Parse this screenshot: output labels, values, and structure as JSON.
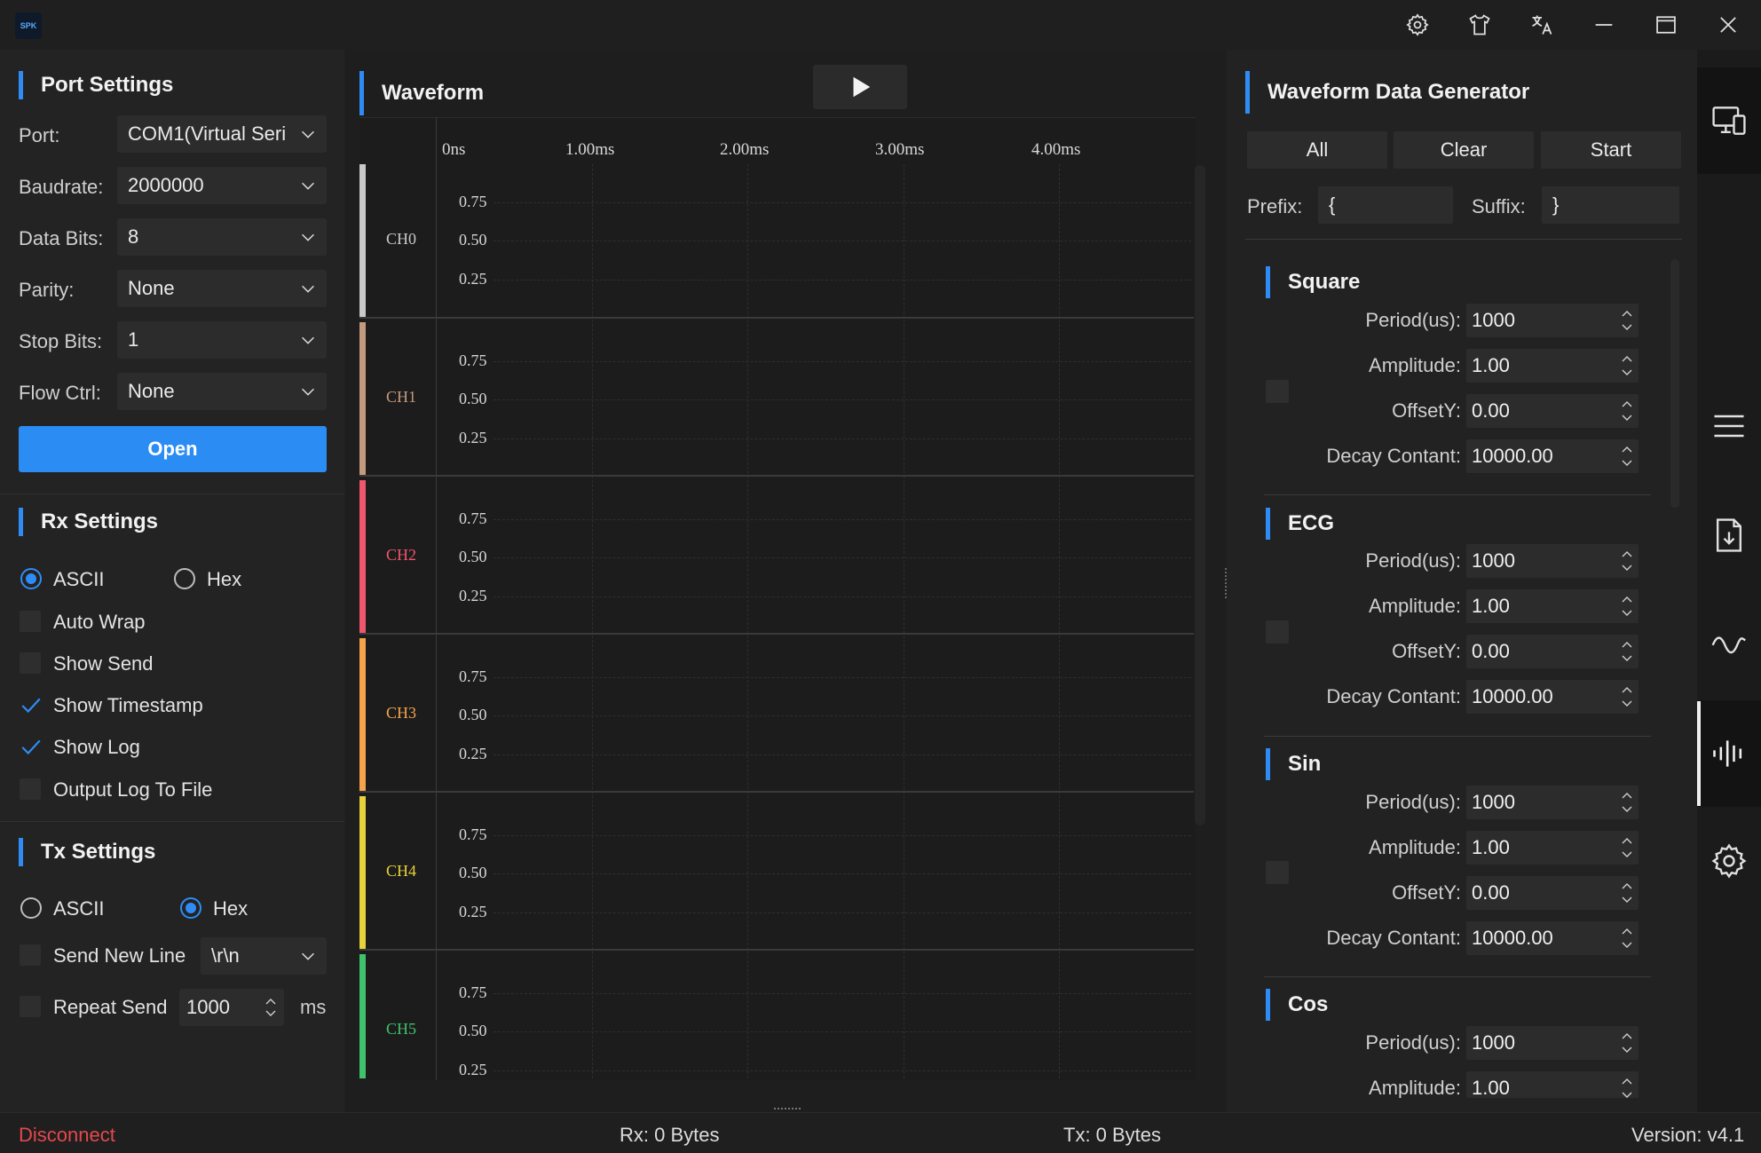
{
  "titlebar": {
    "logo_text": "SPK",
    "icons": [
      "gear-icon",
      "shirt-icon",
      "translate-icon",
      "minimize-icon",
      "maximize-icon",
      "close-icon"
    ]
  },
  "port_settings": {
    "title": "Port Settings",
    "port_label": "Port:",
    "port_value": "COM1(Virtual Seri",
    "baudrate_label": "Baudrate:",
    "baudrate_value": "2000000",
    "databits_label": "Data Bits:",
    "databits_value": "8",
    "parity_label": "Parity:",
    "parity_value": "None",
    "stopbits_label": "Stop Bits:",
    "stopbits_value": "1",
    "flowctrl_label": "Flow Ctrl:",
    "flowctrl_value": "None",
    "open_label": "Open"
  },
  "rx_settings": {
    "title": "Rx Settings",
    "ascii_label": "ASCII",
    "hex_label": "Hex",
    "mode": "ASCII",
    "options": [
      {
        "label": "Auto Wrap",
        "checked": false
      },
      {
        "label": "Show Send",
        "checked": false
      },
      {
        "label": "Show Timestamp",
        "checked": true
      },
      {
        "label": "Show Log",
        "checked": true
      },
      {
        "label": "Output Log To File",
        "checked": false
      }
    ]
  },
  "tx_settings": {
    "title": "Tx Settings",
    "ascii_label": "ASCII",
    "hex_label": "Hex",
    "mode": "Hex",
    "send_new_line_label": "Send New Line",
    "send_new_line_value": "\\r\\n",
    "repeat_send_label": "Repeat Send",
    "repeat_send_value": "1000",
    "repeat_unit": "ms"
  },
  "waveform": {
    "title": "Waveform",
    "time_labels": [
      "0ns",
      "1.00ms",
      "2.00ms",
      "3.00ms",
      "4.00ms"
    ],
    "y_ticks": [
      "0.75",
      "0.50",
      "0.25"
    ],
    "channels": [
      {
        "name": "CH0",
        "color": "#c9c9c9"
      },
      {
        "name": "CH1",
        "color": "#c49a7f"
      },
      {
        "name": "CH2",
        "color": "#f0566e"
      },
      {
        "name": "CH3",
        "color": "#f5a44a"
      },
      {
        "name": "CH4",
        "color": "#e8d23a"
      },
      {
        "name": "CH5",
        "color": "#3fc26b"
      }
    ]
  },
  "generator": {
    "title": "Waveform Data Generator",
    "all_label": "All",
    "clear_label": "Clear",
    "start_label": "Start",
    "prefix_label": "Prefix:",
    "prefix_value": "{",
    "suffix_label": "Suffix:",
    "suffix_value": "}",
    "waves": [
      {
        "name": "Square",
        "period_label": "Period(us):",
        "period": "1000",
        "amplitude_label": "Amplitude:",
        "amplitude": "1.00",
        "offset_label": "OffsetY:",
        "offset": "0.00",
        "decay_label": "Decay Contant:",
        "decay": "10000.00"
      },
      {
        "name": "ECG",
        "period_label": "Period(us):",
        "period": "1000",
        "amplitude_label": "Amplitude:",
        "amplitude": "1.00",
        "offset_label": "OffsetY:",
        "offset": "0.00",
        "decay_label": "Decay Contant:",
        "decay": "10000.00"
      },
      {
        "name": "Sin",
        "period_label": "Period(us):",
        "period": "1000",
        "amplitude_label": "Amplitude:",
        "amplitude": "1.00",
        "offset_label": "OffsetY:",
        "offset": "0.00",
        "decay_label": "Decay Contant:",
        "decay": "10000.00"
      },
      {
        "name": "Cos",
        "period_label": "Period(us):",
        "period": "1000",
        "amplitude_label": "Amplitude:",
        "amplitude": "1.00"
      }
    ]
  },
  "sidenav": {
    "items": [
      "devices-icon",
      "menu-icon",
      "download-file-icon",
      "sine-wave-icon",
      "waveform-icon",
      "settings-icon"
    ],
    "active": "waveform-icon"
  },
  "status": {
    "connection": "Disconnect",
    "connection_color": "#e5484d",
    "rx": "Rx: 0 Bytes",
    "tx": "Tx: 0 Bytes",
    "version": "Version: v4.1"
  }
}
